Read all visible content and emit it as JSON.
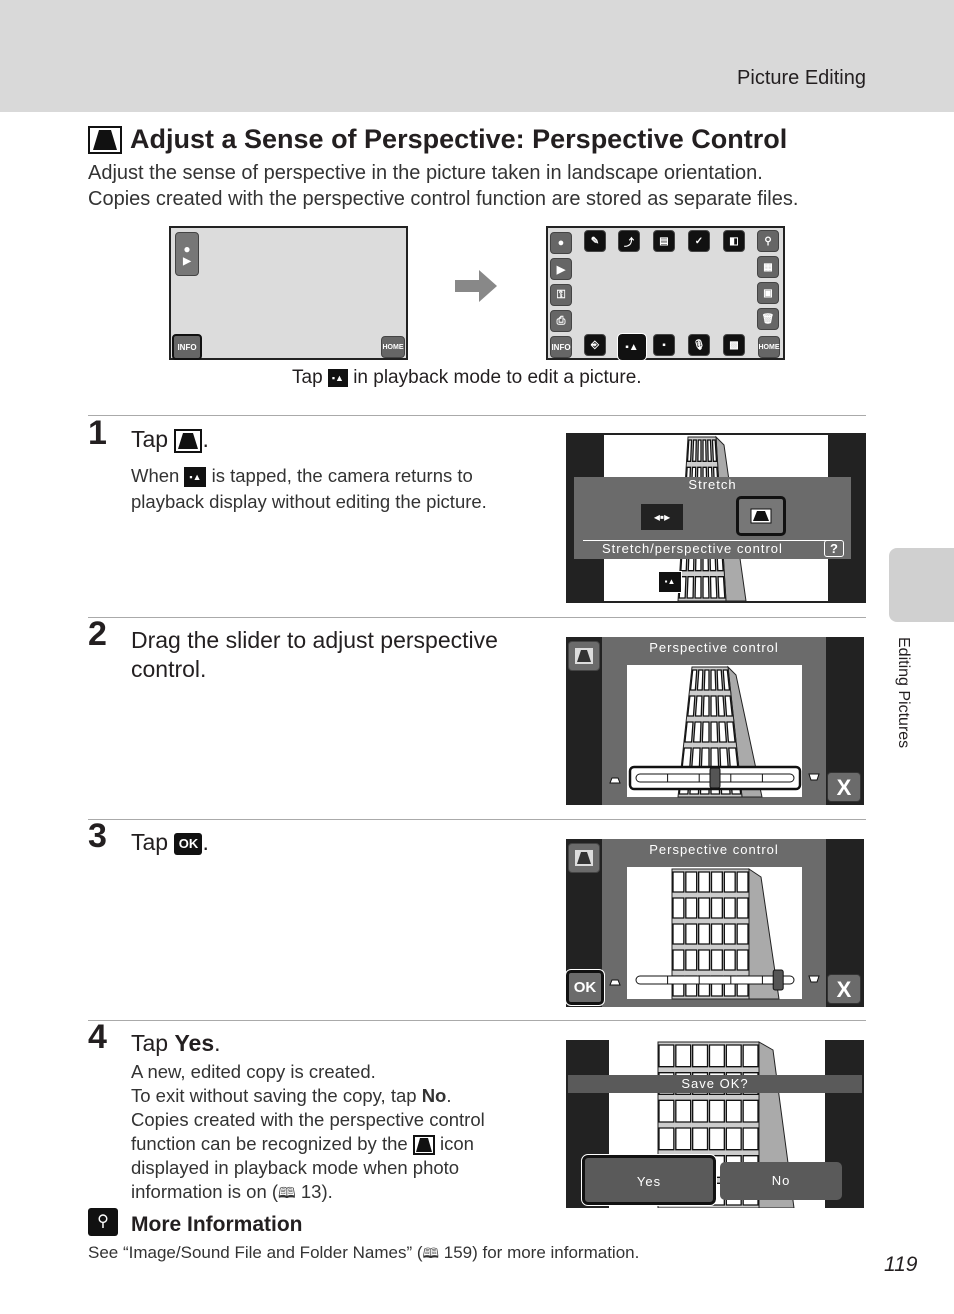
{
  "header": {
    "section": "Picture Editing"
  },
  "title": {
    "icon": "perspective-control-icon",
    "text": "Adjust a Sense of Perspective: Perspective Control"
  },
  "intro": [
    "Adjust the sense of perspective in the picture taken in landscape orientation.",
    "Copies created with the perspective control function are stored as separate files."
  ],
  "figure": {
    "info_label": "INFO",
    "home_label": "HOME",
    "caption_before": "Tap",
    "caption_icon": "edit-icon",
    "caption_after": "in playback mode to edit a picture."
  },
  "steps": [
    {
      "number": "1",
      "title_before": "Tap",
      "title_icon": "perspective-control-icon",
      "title_after": ".",
      "body_before": "When",
      "body_icon": "edit-icon",
      "body_after": "is tapped, the camera returns to",
      "body_line2": "playback display without editing the picture.",
      "screen": {
        "menu_title": "Stretch",
        "menu_subtitle": "Stretch/perspective control",
        "help": "?"
      }
    },
    {
      "number": "2",
      "title_lines": [
        "Drag the slider to adjust perspective",
        "control."
      ],
      "screen": {
        "title": "Perspective control",
        "slider_value": 0.5,
        "close": "X"
      }
    },
    {
      "number": "3",
      "title_before": "Tap",
      "title_icon": "ok-icon",
      "title_after": ".",
      "screen": {
        "title": "Perspective control",
        "slider_value": 0.9,
        "ok": "OK",
        "close": "X"
      }
    },
    {
      "number": "4",
      "title_before": "Tap ",
      "title_bold": "Yes",
      "title_after": ".",
      "body": [
        "A new, edited copy is created."
      ],
      "exit_before": "To exit without saving the copy, tap ",
      "exit_bold": "No",
      "exit_after": ".",
      "body2": [
        "Copies created with the perspective control"
      ],
      "recog_before": "function can be recognized by the",
      "recog_after": "icon",
      "body3": [
        "displayed in playback mode when photo"
      ],
      "info_before": "information is on (",
      "info_ref": "13",
      "info_after": ").",
      "screen": {
        "prompt": "Save OK?",
        "yes": "Yes",
        "no": "No"
      }
    }
  ],
  "more_info": {
    "title": "More Information",
    "text_before": "See “Image/Sound File and Folder Names” (",
    "ref": "159",
    "text_after": ") for more information."
  },
  "side_tab": "Editing Pictures",
  "page_number": "119",
  "colors": {
    "header_bg": "#d9d9d9",
    "screen_dark": "#222222",
    "panel_gray": "#6b6b6b"
  }
}
